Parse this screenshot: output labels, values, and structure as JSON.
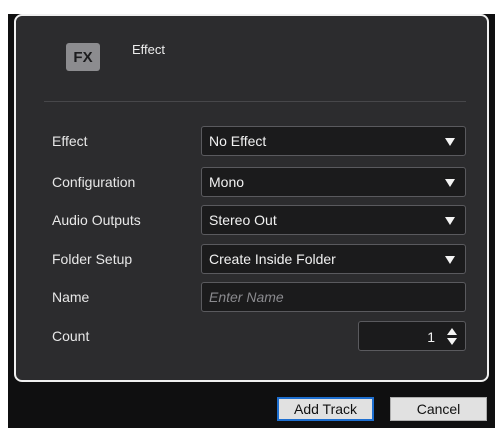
{
  "header": {
    "badge": "FX",
    "title": "Effect"
  },
  "form": {
    "effect": {
      "label": "Effect",
      "value": "No Effect"
    },
    "configuration": {
      "label": "Configuration",
      "value": "Mono"
    },
    "audio_outputs": {
      "label": "Audio Outputs",
      "value": "Stereo Out"
    },
    "folder_setup": {
      "label": "Folder Setup",
      "value": "Create Inside Folder"
    },
    "name": {
      "label": "Name",
      "value": "",
      "placeholder": "Enter Name"
    },
    "count": {
      "label": "Count",
      "value": "1"
    }
  },
  "buttons": {
    "add_track": "Add Track",
    "cancel": "Cancel"
  },
  "colors": {
    "panel_bg": "#2c2c2e",
    "field_bg": "#1b1b1c",
    "badge_bg": "#8c8c8f",
    "primary_border": "#1e6fd0"
  }
}
